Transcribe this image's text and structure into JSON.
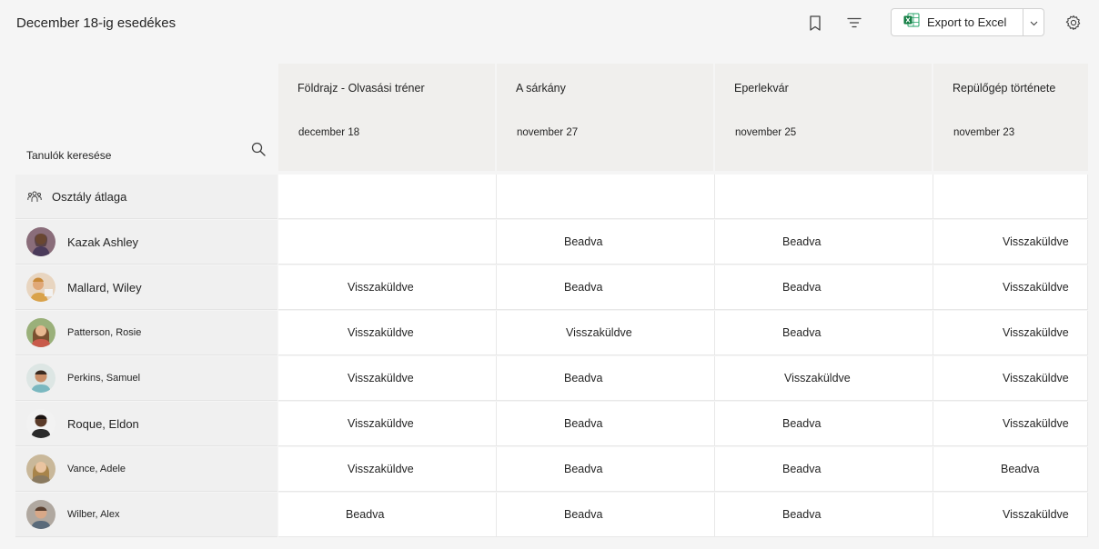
{
  "header": {
    "title": "December 18-ig esedékes",
    "export_label": "Export to Excel"
  },
  "search": {
    "label": "Tanulók keresése"
  },
  "columns": [
    {
      "title": "Földrajz - Olvasási tréner",
      "date": "december 18"
    },
    {
      "title": "A sárkány",
      "date": "november 27"
    },
    {
      "title": "Eperlekvár",
      "date": "november 25"
    },
    {
      "title": "Repülőgép története",
      "date": "november 23"
    }
  ],
  "class_average": {
    "label": "Osztály átlaga"
  },
  "students": [
    {
      "name": "Kazak Ashley",
      "statuses": [
        "",
        "Beadva",
        "Beadva",
        "Visszaküldve"
      ]
    },
    {
      "name": "Mallard, Wiley",
      "statuses": [
        "Visszaküldve",
        "Beadva",
        "Beadva",
        "Visszaküldve"
      ]
    },
    {
      "name": "Patterson, Rosie",
      "statuses": [
        "Visszaküldve",
        "Visszaküldve",
        "Beadva",
        "Visszaküldve"
      ]
    },
    {
      "name": "Perkins, Samuel",
      "statuses": [
        "Visszaküldve",
        "Beadva",
        "Visszaküldve",
        "Visszaküldve"
      ]
    },
    {
      "name": "Roque, Eldon",
      "statuses": [
        "Visszaküldve",
        "Beadva",
        "Beadva",
        "Visszaküldve"
      ]
    },
    {
      "name": "Vance, Adele",
      "statuses": [
        "Visszaküldve",
        "Beadva",
        "Beadva",
        "Beadva"
      ]
    },
    {
      "name": "Wilber, Alex",
      "statuses": [
        "Beadva",
        "Beadva",
        "Beadva",
        "Visszaküldve"
      ]
    }
  ],
  "colors": {
    "excel_green": "#107c41",
    "header_bg": "#f0efed"
  }
}
